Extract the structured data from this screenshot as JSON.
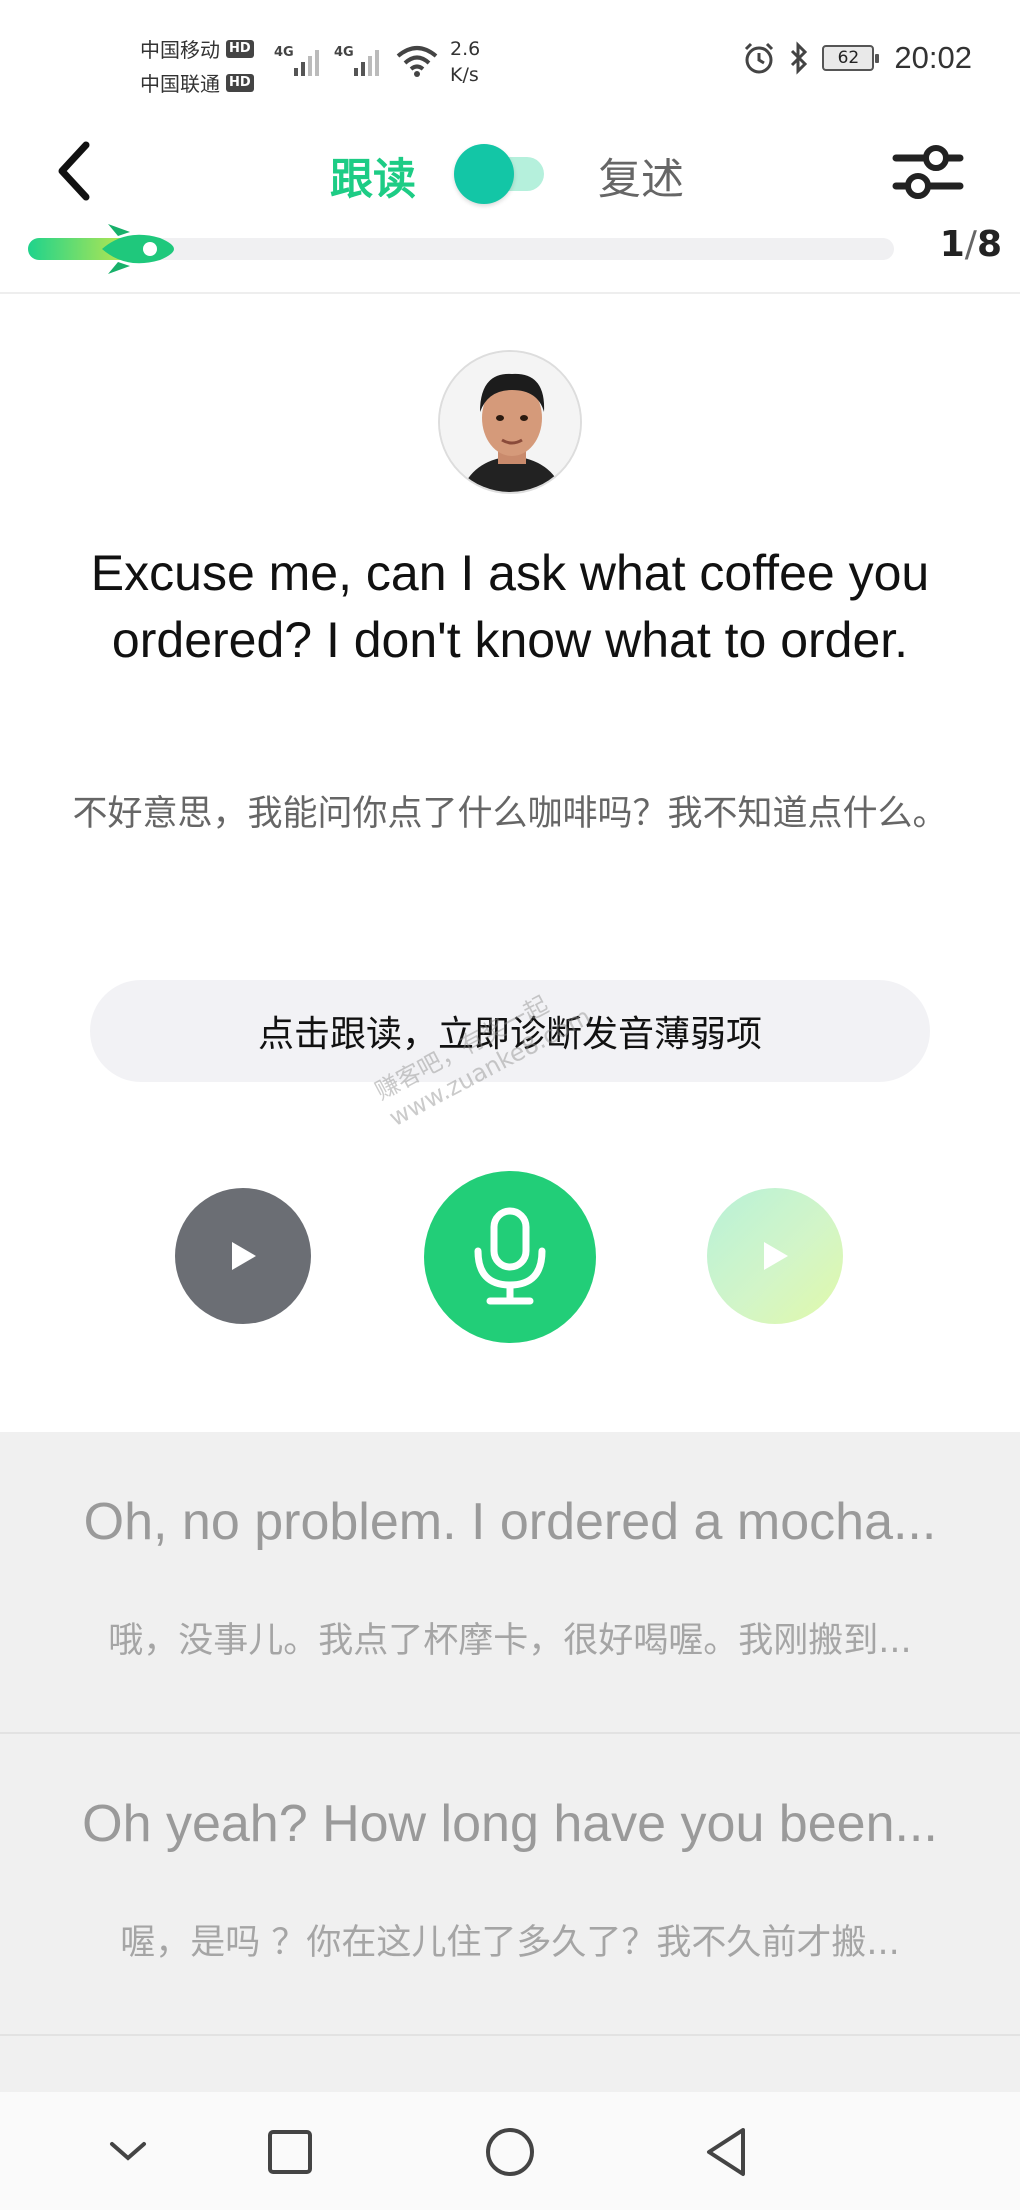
{
  "status_bar": {
    "carrier1": "中国移动",
    "carrier2": "中国联通",
    "hd": "HD",
    "net1": "4G",
    "net2": "4G",
    "speed_value": "2.6",
    "speed_unit": "K/s",
    "battery": "62",
    "time": "20:02"
  },
  "header": {
    "mode_left": "跟读",
    "mode_right": "复述",
    "toggle_on": true
  },
  "progress": {
    "current": "1",
    "separator": "/",
    "total": "8",
    "fraction": 0.125
  },
  "main": {
    "sentence_en": "Excuse me, can I ask what coffee you ordered? I don't know what to order.",
    "sentence_zh": "不好意思，我能问你点了什么咖啡吗？我不知道点什么。",
    "hint": "点击跟读，立即诊断发音薄弱项"
  },
  "watermark": {
    "line1": "赚客吧，有奖一起",
    "line2": "www.zuanke8.com"
  },
  "next_sentences": [
    {
      "en": "Oh, no problem. I ordered a mocha...",
      "zh": "哦，没事儿。我点了杯摩卡，很好喝喔。我刚搬到..."
    },
    {
      "en": "Oh yeah? How long have you been...",
      "zh": "喔，是吗 ？你在这儿住了多久了？我不久前才搬..."
    }
  ],
  "colors": {
    "accent": "#1dcc85",
    "mic": "#22ce78",
    "toggle_knob": "#13c6a6",
    "play_gray": "#6b6e74"
  },
  "icons": {
    "back": "chevron-left-icon",
    "settings": "sliders-icon",
    "play": "play-icon",
    "mic": "microphone-icon",
    "replay": "play-icon",
    "nav_down": "chevron-down-icon",
    "nav_recent": "square-icon",
    "nav_home": "circle-icon",
    "nav_back": "triangle-back-icon"
  }
}
